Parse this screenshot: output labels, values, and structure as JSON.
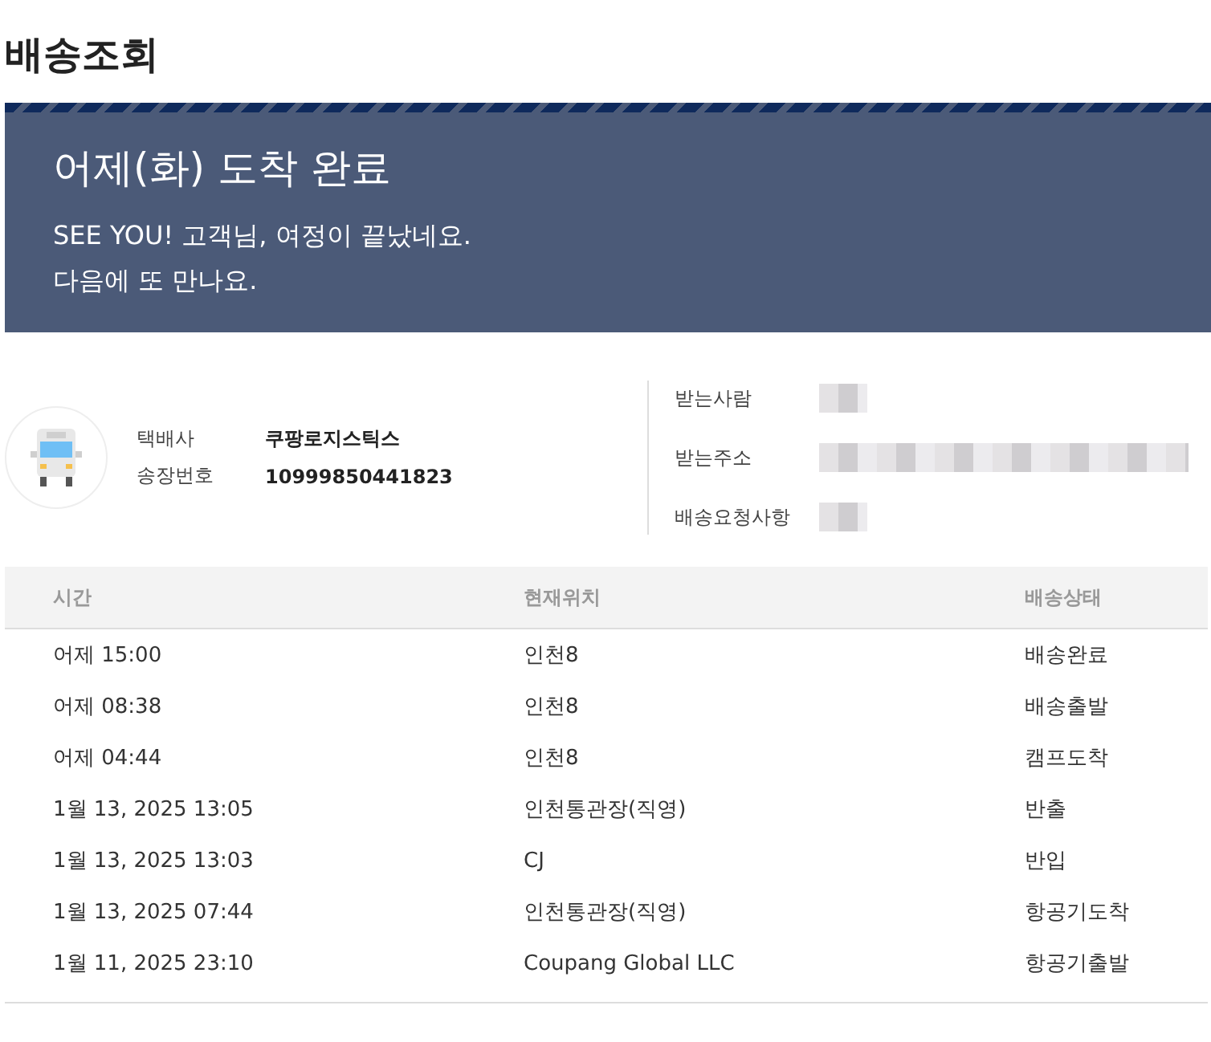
{
  "page_title": "배송조회",
  "banner": {
    "headline": "어제(화) 도착 완료",
    "message_lines": [
      "SEE YOU! 고객님, 여정이 끝났네요.",
      "다음에 또 만나요."
    ]
  },
  "shipment": {
    "fields": [
      {
        "label": "택배사",
        "value": "쿠팡로지스틱스"
      },
      {
        "label": "송장번호",
        "value": "10999850441823"
      }
    ]
  },
  "recipient": {
    "fields": [
      {
        "label": "받는사람"
      },
      {
        "label": "받는주소"
      },
      {
        "label": "배송요청사항"
      }
    ]
  },
  "table": {
    "columns": [
      "시간",
      "현재위치",
      "배송상태"
    ],
    "rows": [
      [
        "어제 15:00",
        "인천8",
        "배송완료"
      ],
      [
        "어제 08:38",
        "인천8",
        "배송출발"
      ],
      [
        "어제 04:44",
        "인천8",
        "캠프도착"
      ],
      [
        "1월 13, 2025 13:05",
        "인천통관장(직영)",
        "반출"
      ],
      [
        "1월 13, 2025 13:03",
        "CJ",
        "반입"
      ],
      [
        "1월 13, 2025 07:44",
        "인천통관장(직영)",
        "항공기도착"
      ],
      [
        "1월 11, 2025 23:10",
        "Coupang Global LLC",
        "항공기출발"
      ]
    ]
  }
}
